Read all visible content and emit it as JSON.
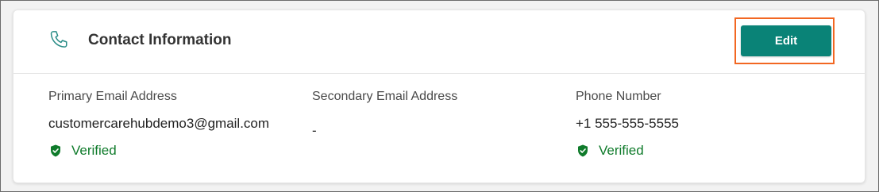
{
  "header": {
    "icon": "phone-icon",
    "title": "Contact Information",
    "edit_label": "Edit"
  },
  "fields": {
    "primary_email": {
      "label": "Primary Email Address",
      "value": "customercarehubdemo3@gmail.com",
      "status": "Verified",
      "status_icon": "shield-check-icon"
    },
    "secondary_email": {
      "label": "Secondary Email Address",
      "value": "-"
    },
    "phone": {
      "label": "Phone Number",
      "value": "+1 555-555-5555",
      "status": "Verified",
      "status_icon": "shield-check-icon"
    }
  },
  "colors": {
    "accent": "#0a8377",
    "verified": "#0f7b2b",
    "highlight": "#f26722",
    "icon": "#2a8c86"
  }
}
